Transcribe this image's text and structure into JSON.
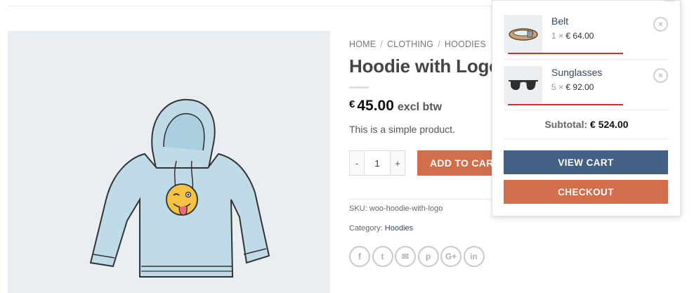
{
  "breadcrumb": {
    "items": [
      "HOME",
      "CLOTHING",
      "HOODIES"
    ],
    "separator": "/"
  },
  "product": {
    "title": "Hoodie with Logo",
    "price_currency": "€",
    "price_amount": "45.00",
    "price_suffix": "excl btw",
    "description": "This is a simple product.",
    "quantity": "1",
    "qty_minus": "-",
    "qty_plus": "+",
    "add_to_cart_label": "ADD TO CART",
    "sku_label": "SKU:",
    "sku_value": "woo-hoodie-with-logo",
    "category_label": "Category:",
    "category_value": "Hoodies",
    "image_icon": "hoodie-with-emoji-logo"
  },
  "share": {
    "icons": [
      "facebook-icon",
      "twitter-icon",
      "email-icon",
      "pinterest-icon",
      "google-plus-icon",
      "linkedin-icon"
    ],
    "glyphs": [
      "f",
      "t",
      "✉",
      "p",
      "G+",
      "in"
    ]
  },
  "mini_cart": {
    "items": [
      {
        "name": "Belt",
        "qty": "1",
        "times": "×",
        "price": "€ 64.00",
        "remove": "×",
        "icon": "belt-icon"
      },
      {
        "name": "Sunglasses",
        "qty": "5",
        "times": "×",
        "price": "€ 92.00",
        "remove": "×",
        "icon": "sunglasses-icon"
      }
    ],
    "subtotal_label": "Subtotal:",
    "subtotal_value": "€ 524.00",
    "view_cart_label": "VIEW CART",
    "checkout_label": "CHECKOUT"
  },
  "colors": {
    "accent_orange": "#d26e4b",
    "primary_blue": "#446084",
    "link_blue": "#334862",
    "underline_red": "#d32f2f",
    "image_bg": "#e9eef2"
  }
}
